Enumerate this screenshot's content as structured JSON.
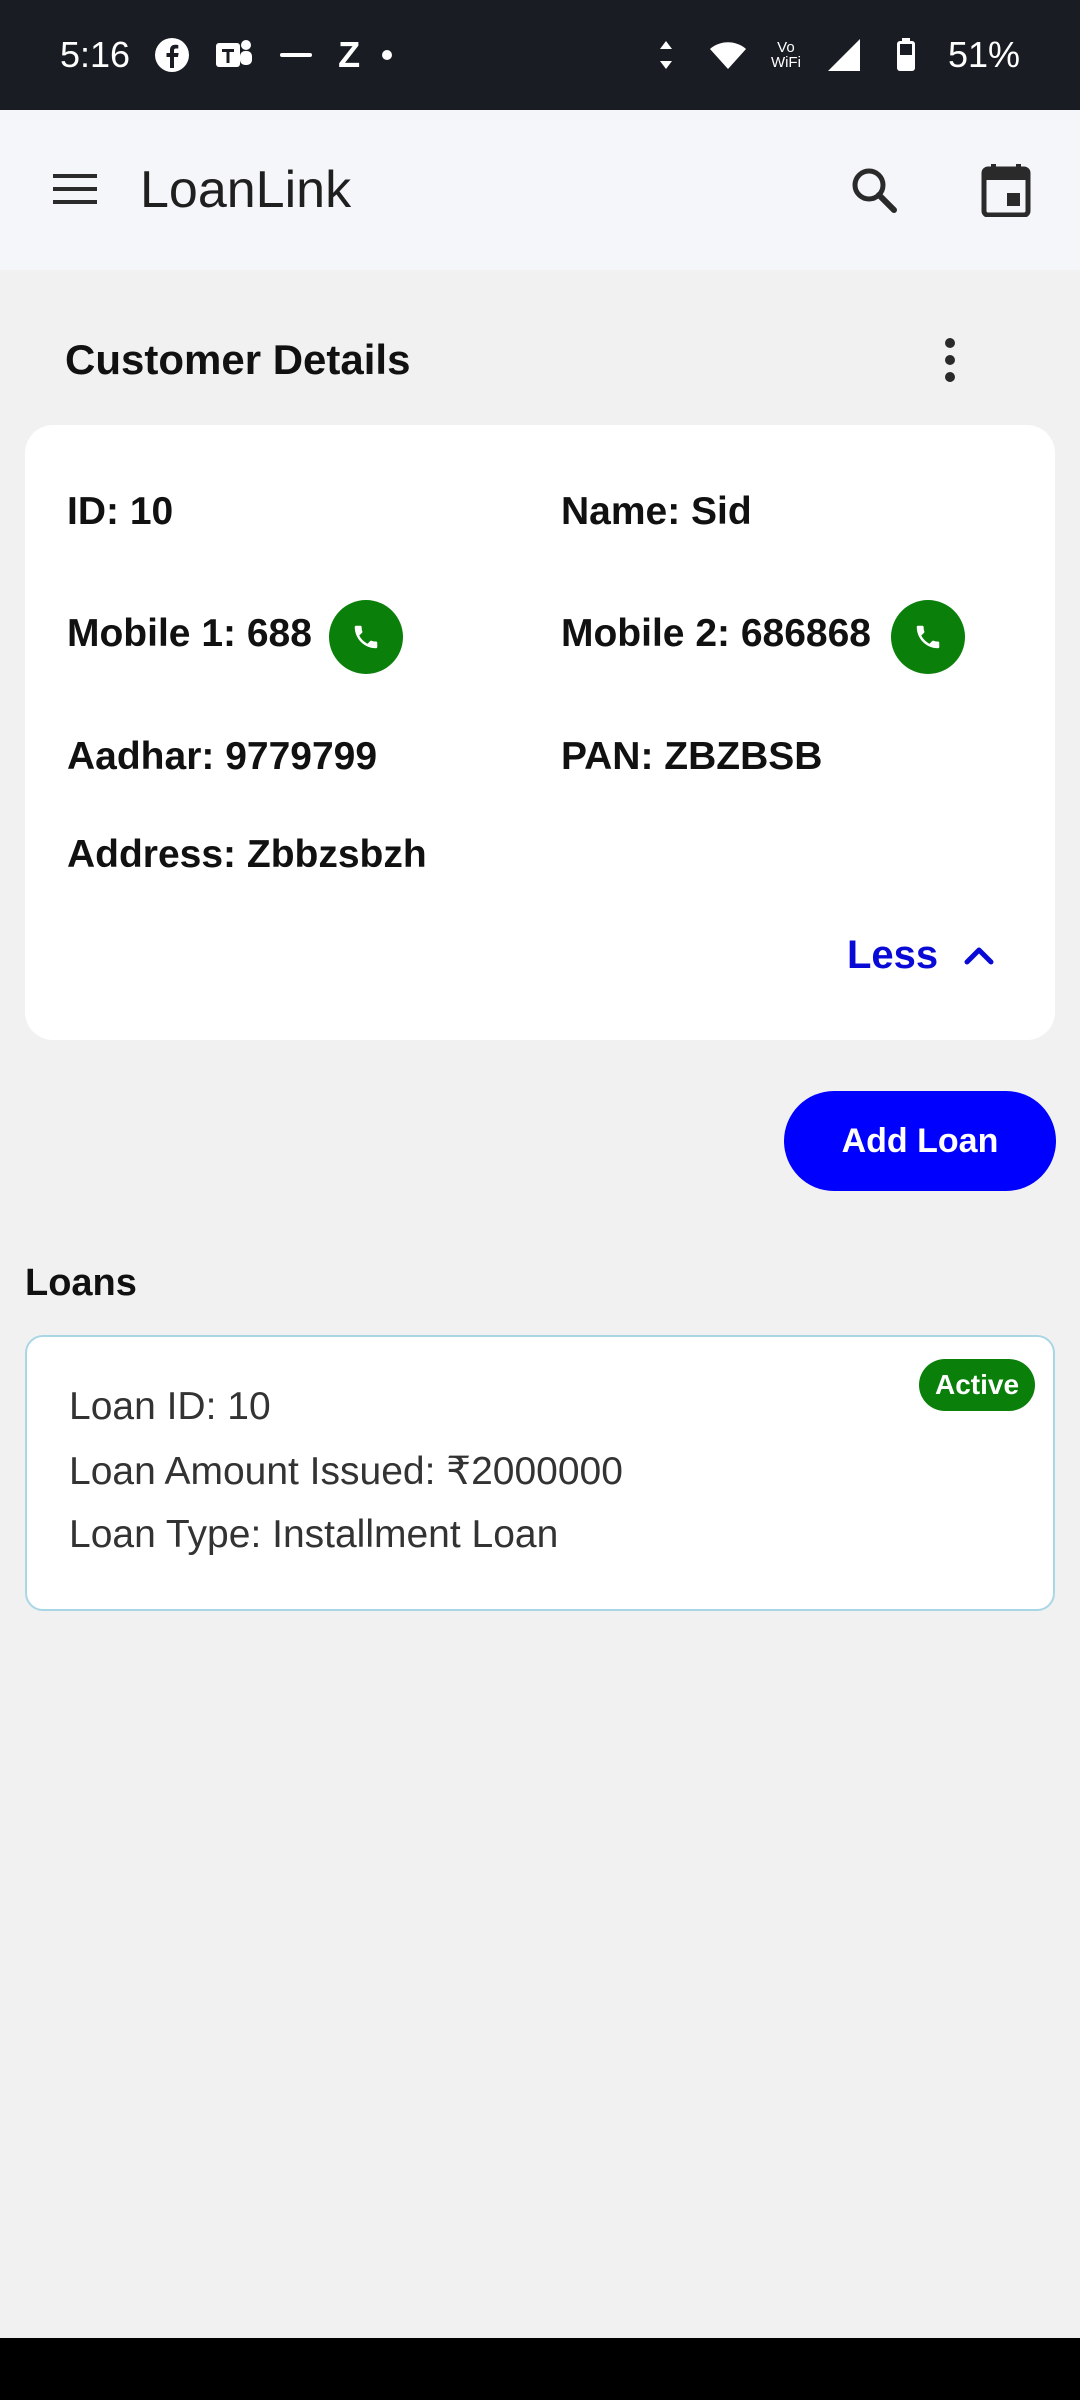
{
  "status_bar": {
    "time": "5:16",
    "vowifi": "Vo\nWiFi",
    "battery": "51%"
  },
  "app_bar": {
    "title": "LoanLink"
  },
  "customer": {
    "section_title": "Customer Details",
    "id": "ID: 10",
    "name": "Name: Sid",
    "mobile1": "Mobile 1: 688",
    "mobile2": "Mobile 2: 686868",
    "aadhar": "Aadhar: 9779799",
    "pan": "PAN: ZBZBSB",
    "address": "Address: Zbbzsbzh",
    "less_label": "Less"
  },
  "actions": {
    "add_loan_label": "Add Loan"
  },
  "loans": {
    "heading": "Loans",
    "items": [
      {
        "loan_id": "Loan ID: 10",
        "amount": "Loan Amount Issued: ₹2000000",
        "type": "Loan Type: Installment Loan",
        "status": "Active"
      }
    ]
  },
  "colors": {
    "primary_button": "#0000ff",
    "call_button": "#0a7f0a",
    "active_badge": "#0a7f0a",
    "link_blue": "#0a0ad6"
  }
}
